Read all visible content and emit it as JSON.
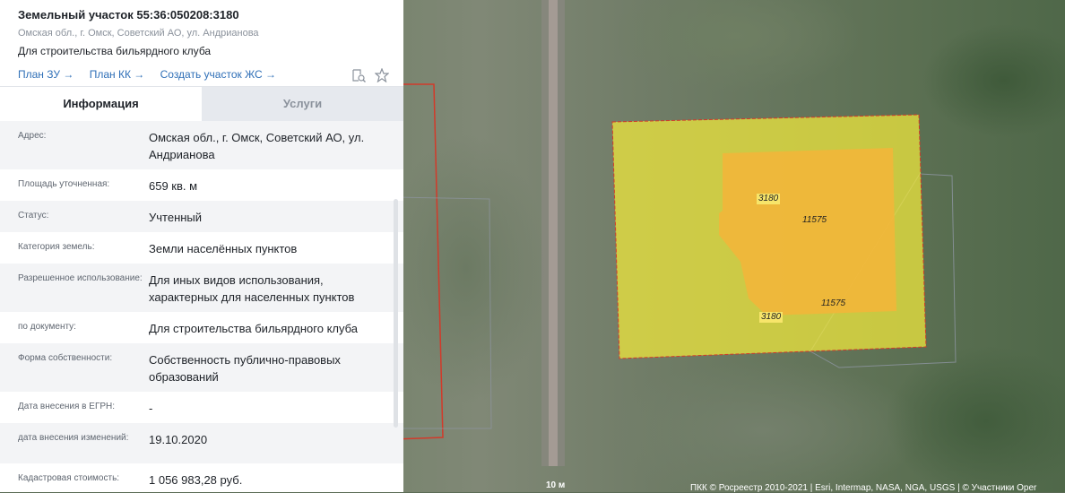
{
  "header": {
    "title": "Земельный участок 55:36:050208:3180",
    "address": "Омская обл., г. Омск, Советский АО, ул. Андрианова",
    "purpose": "Для строительства бильярдного клуба",
    "links": [
      "План ЗУ →",
      "План КК →",
      "Создать участок ЖС →"
    ],
    "icons": [
      "search-document-icon",
      "star-icon"
    ]
  },
  "tabs": {
    "info": "Информация",
    "services": "Услуги"
  },
  "rows": [
    {
      "label": "Адрес:",
      "value": "Омская обл., г. Омск, Советский АО, ул. Андрианова"
    },
    {
      "label": "Площадь уточненная:",
      "value": "659 кв. м"
    },
    {
      "label": "Статус:",
      "value": "Учтенный"
    },
    {
      "label": "Категория земель:",
      "value": "Земли населённых пунктов"
    },
    {
      "label": "Разрешенное использование:",
      "value": "Для иных видов использования, характерных для населенных пунктов"
    },
    {
      "label": "по документу:",
      "value": "Для строительства бильярдного клуба"
    },
    {
      "label": "Форма собственности:",
      "value": "Собственность публично-правовых образований"
    },
    {
      "label": "Дата внесения в ЕГРН:",
      "value": "-"
    },
    {
      "label": "дата внесения изменений:",
      "value": "19.10.2020"
    },
    {
      "label": "Кадастровая стоимость:",
      "value": "1 056 983,28 руб."
    }
  ],
  "map": {
    "labels": [
      "3180",
      "11575",
      "11575",
      "3180"
    ],
    "scale": "10 м",
    "attribution": "ПКК © Росреестр 2010-2021 | Esri, Intermap, NASA, NGA, USGS | © Участники Oper",
    "colors": {
      "parcel": "#f2ea3c",
      "building": "#f2b63a",
      "border": "#d23a2a",
      "link": "#2f6fb7"
    }
  }
}
